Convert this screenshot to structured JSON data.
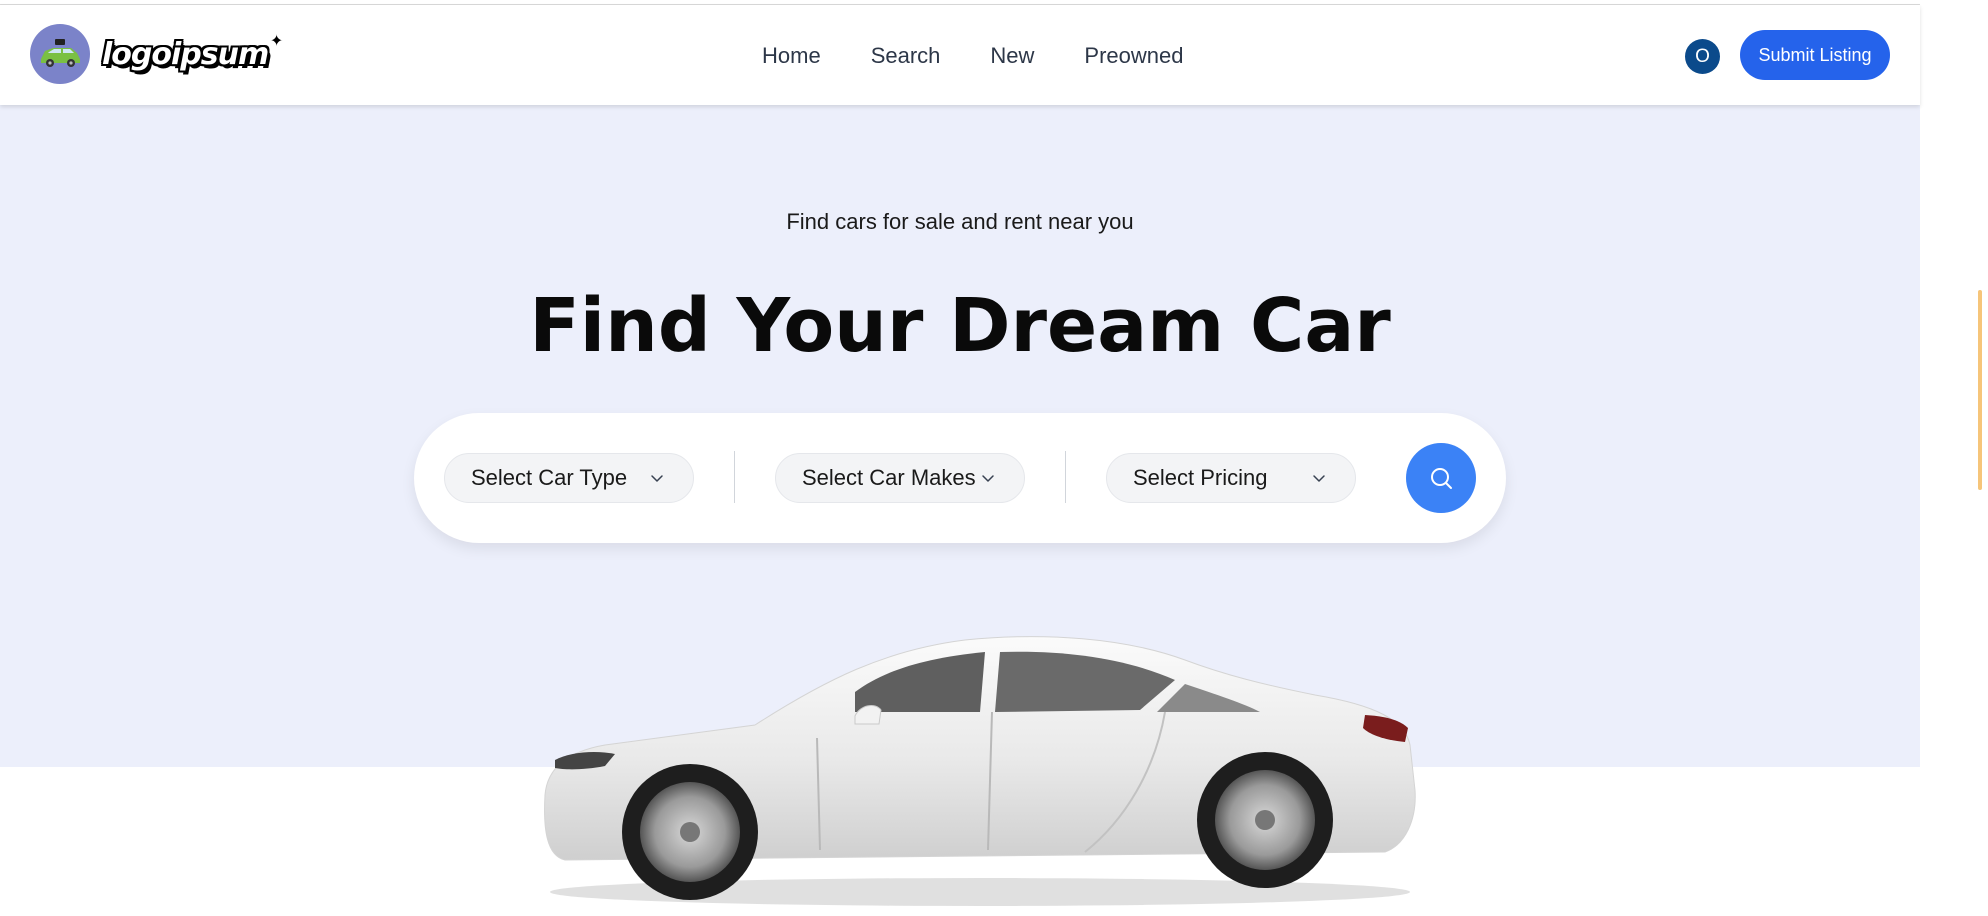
{
  "header": {
    "logo_text": "logoipsum",
    "nav": [
      {
        "label": "Home"
      },
      {
        "label": "Search"
      },
      {
        "label": "New"
      },
      {
        "label": "Preowned"
      }
    ],
    "badge_text": "O",
    "submit_label": "Submit Listing"
  },
  "hero": {
    "subtitle": "Find cars for sale and rent near you",
    "title": "Find Your Dream Car",
    "search": {
      "car_type_label": "Select Car Type",
      "car_makes_label": "Select Car Makes",
      "pricing_label": "Select Pricing"
    }
  },
  "colors": {
    "accent": "#2563eb",
    "search_button": "#3b82f6",
    "hero_background": "#eceffb",
    "badge": "#0b4a8b"
  },
  "icons": {
    "search": "search-icon",
    "chevron": "chevron-down-icon",
    "logo": "car-logo-icon"
  }
}
